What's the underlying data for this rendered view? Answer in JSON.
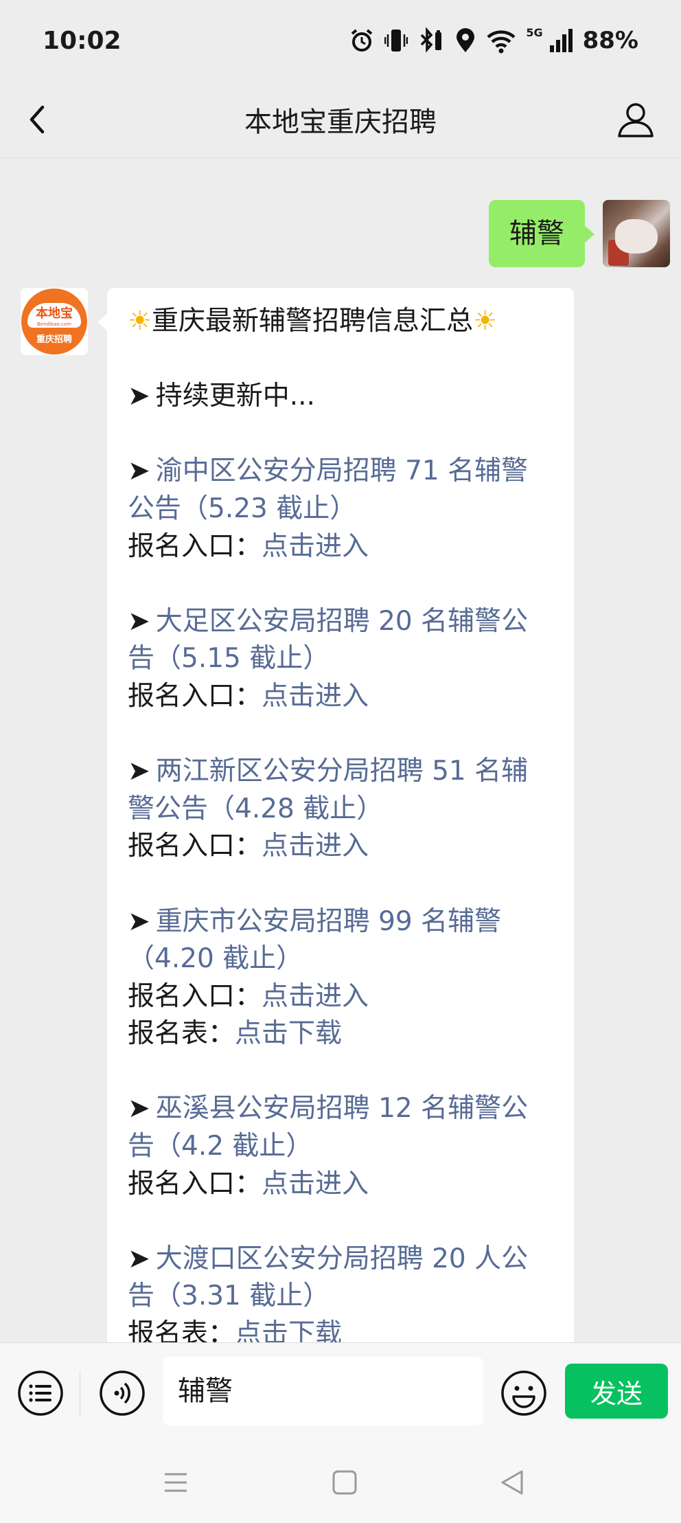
{
  "status_bar": {
    "time": "10:02",
    "network": "5G",
    "battery": "88%"
  },
  "header": {
    "title": "本地宝重庆招聘"
  },
  "messages": {
    "user_text": "辅警",
    "bot": {
      "logo_brand": "本地宝",
      "logo_url": "Bendibao.com",
      "logo_city": "重庆招聘",
      "title": "重庆最新辅警招聘信息汇总",
      "sun": "☀",
      "arrow": "➤",
      "updating": "持续更新中...",
      "items": [
        {
          "link": "渝中区公安分局招聘 71 名辅警公告（5.23 截止）",
          "entry_label": "报名入口：",
          "entry_link": "点击进入"
        },
        {
          "link": "大足区公安局招聘 20 名辅警公告（5.15 截止）",
          "entry_label": "报名入口：",
          "entry_link": "点击进入"
        },
        {
          "link": "两江新区公安分局招聘 51 名辅警公告（4.28 截止）",
          "entry_label": "报名入口：",
          "entry_link": "点击进入"
        },
        {
          "link": "重庆市公安局招聘 99 名辅警（4.20 截止）",
          "entry_label": "报名入口：",
          "entry_link": "点击进入",
          "form_label": "报名表：",
          "form_link": "点击下载"
        },
        {
          "link": "巫溪县公安局招聘 12 名辅警公告（4.2 截止）",
          "entry_label": "报名入口：",
          "entry_link": "点击进入"
        },
        {
          "link": "大渡口区公安分局招聘 20 人公告（3.31 截止）",
          "form_label": "报名表：",
          "form_link": "点击下载"
        }
      ]
    }
  },
  "input_bar": {
    "value": "辅警",
    "send_label": "发送"
  },
  "colors": {
    "green_bubble": "#95ec69",
    "link": "#576b95",
    "send": "#07c160",
    "logo": "#f07322"
  },
  "icons": [
    "back-arrow-icon",
    "profile-icon",
    "menu-list-icon",
    "voice-icon",
    "emoji-icon",
    "alarm-icon",
    "vibrate-icon",
    "bluetooth-icon",
    "location-icon",
    "wifi-icon",
    "signal-icon"
  ]
}
